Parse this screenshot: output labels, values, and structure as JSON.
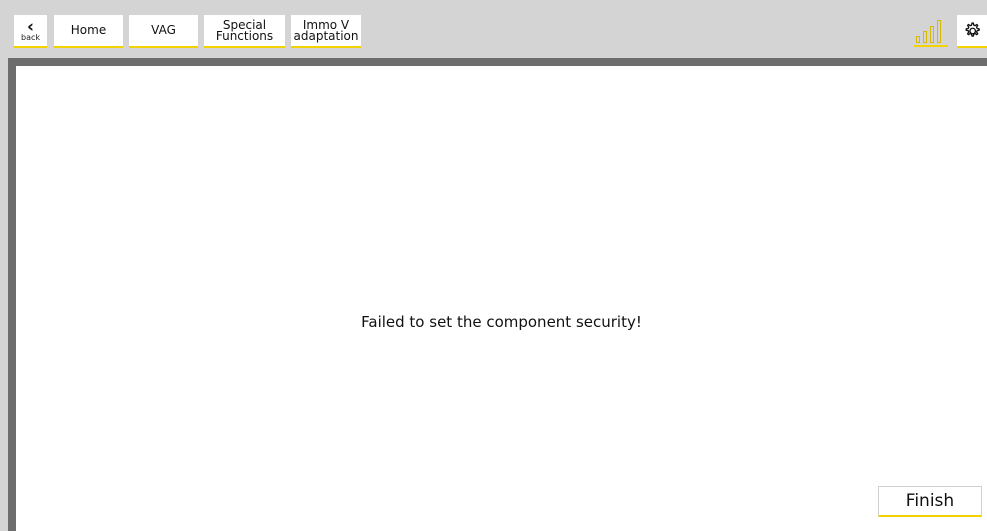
{
  "nav": {
    "back_label": "back",
    "home_label": "Home",
    "vag_label": "VAG",
    "special_functions_label": "Special\nFunctions",
    "immo_label": "Immo V\nadaptation"
  },
  "status": {
    "signal_icon": "signal-strength-icon",
    "settings_icon": "gear-icon"
  },
  "main": {
    "message": "Failed to set the component security!"
  },
  "footer": {
    "finish_label": "Finish"
  },
  "colors": {
    "accent": "#f2d300",
    "topbar_bg": "#d4d4d4",
    "panel_border": "#6d6d6d"
  }
}
